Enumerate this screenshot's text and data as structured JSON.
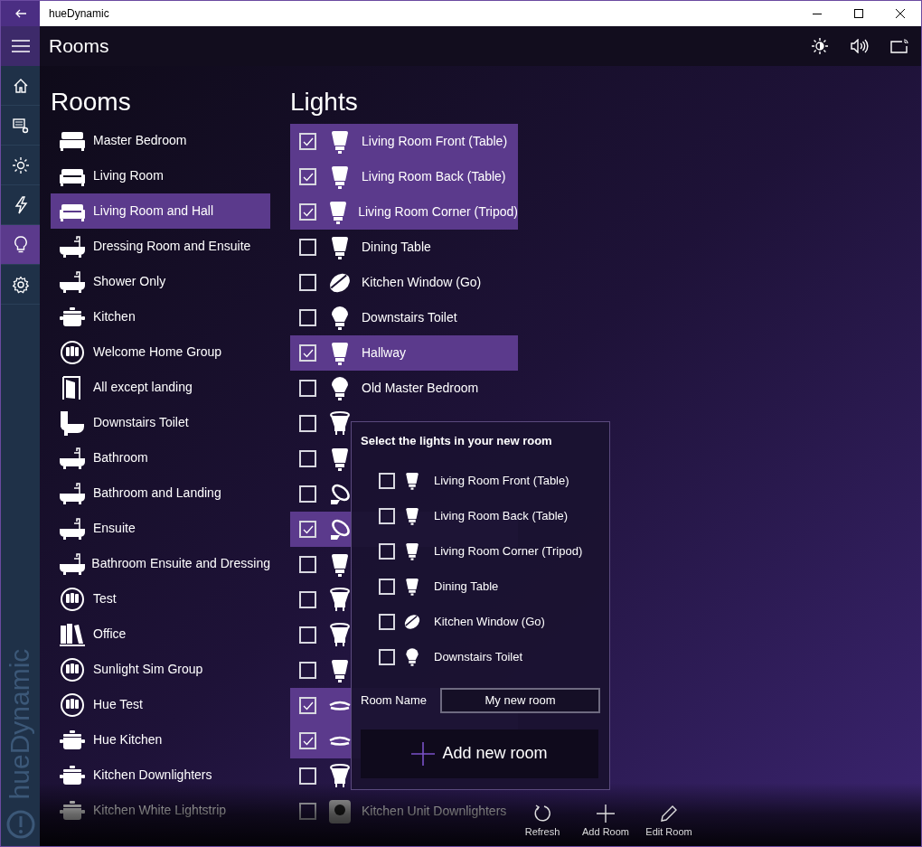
{
  "window": {
    "title": "hueDynamic"
  },
  "nav": {
    "brand": "hueDynamic",
    "items": [
      {
        "kind": "home",
        "selected": false
      },
      {
        "kind": "devices",
        "selected": false
      },
      {
        "kind": "sun",
        "selected": false
      },
      {
        "kind": "bolt",
        "selected": false
      },
      {
        "kind": "bulb",
        "selected": true
      },
      {
        "kind": "gear",
        "selected": false
      }
    ]
  },
  "header": {
    "title": "Rooms"
  },
  "rooms": {
    "heading": "Rooms",
    "items": [
      {
        "name": "Master Bedroom",
        "kind": "bed",
        "selected": false
      },
      {
        "name": "Living Room",
        "kind": "sofa",
        "selected": false
      },
      {
        "name": "Living Room and Hall",
        "kind": "sofa",
        "selected": true
      },
      {
        "name": "Dressing Room and Ensuite",
        "kind": "bath",
        "selected": false
      },
      {
        "name": "Shower Only",
        "kind": "bath",
        "selected": false
      },
      {
        "name": "Kitchen",
        "kind": "pot",
        "selected": false
      },
      {
        "name": "Welcome Home Group",
        "kind": "group",
        "selected": false
      },
      {
        "name": "All except landing",
        "kind": "door",
        "selected": false
      },
      {
        "name": "Downstairs Toilet",
        "kind": "toilet",
        "selected": false
      },
      {
        "name": "Bathroom",
        "kind": "bath",
        "selected": false
      },
      {
        "name": "Bathroom and Landing",
        "kind": "bath",
        "selected": false
      },
      {
        "name": "Ensuite",
        "kind": "bath",
        "selected": false
      },
      {
        "name": "Bathroom Ensuite and Dressing",
        "kind": "bath",
        "selected": false
      },
      {
        "name": "Test",
        "kind": "group",
        "selected": false
      },
      {
        "name": "Office",
        "kind": "books",
        "selected": false
      },
      {
        "name": "Sunlight Sim Group",
        "kind": "group",
        "selected": false
      },
      {
        "name": "Hue Test",
        "kind": "group",
        "selected": false
      },
      {
        "name": "Hue Kitchen",
        "kind": "pot",
        "selected": false
      },
      {
        "name": "Kitchen Downlighters",
        "kind": "pot",
        "selected": false
      },
      {
        "name": "Kitchen White Lightstrip",
        "kind": "pot",
        "selected": false
      }
    ]
  },
  "lights": {
    "heading": "Lights",
    "items": [
      {
        "name": "Living Room Front (Table)",
        "kind": "tall",
        "checked": true
      },
      {
        "name": "Living Room Back (Table)",
        "kind": "tall",
        "checked": true
      },
      {
        "name": "Living Room Corner (Tripod)",
        "kind": "tall",
        "checked": true
      },
      {
        "name": "Dining Table",
        "kind": "tall",
        "checked": false
      },
      {
        "name": "Kitchen Window (Go)",
        "kind": "go",
        "checked": false
      },
      {
        "name": "Downstairs Toilet",
        "kind": "bulb",
        "checked": false
      },
      {
        "name": "Hallway",
        "kind": "tall",
        "checked": true
      },
      {
        "name": "Old Master Bedroom",
        "kind": "bulb",
        "checked": false
      },
      {
        "kind": "spot",
        "checked": false
      },
      {
        "kind": "tall",
        "checked": false
      },
      {
        "kind": "bloom",
        "checked": false
      },
      {
        "kind": "bloom",
        "checked": true
      },
      {
        "kind": "tall",
        "checked": false
      },
      {
        "kind": "spot",
        "checked": false
      },
      {
        "kind": "spot",
        "checked": false
      },
      {
        "kind": "tall",
        "checked": false
      },
      {
        "kind": "ceiling",
        "checked": true
      },
      {
        "kind": "ceiling",
        "checked": true
      },
      {
        "kind": "spot",
        "checked": false
      },
      {
        "name": "Kitchen Unit Downlighters",
        "kind": "osram",
        "checked": false
      }
    ]
  },
  "popup": {
    "title": "Select the lights in your new room",
    "items": [
      {
        "name": "Living Room Front (Table)",
        "kind": "tall",
        "checked": false
      },
      {
        "name": "Living Room Back (Table)",
        "kind": "tall",
        "checked": false
      },
      {
        "name": "Living Room Corner (Tripod)",
        "kind": "tall",
        "checked": false
      },
      {
        "name": "Dining Table",
        "kind": "tall",
        "checked": false
      },
      {
        "name": "Kitchen Window (Go)",
        "kind": "go",
        "checked": false
      },
      {
        "name": "Downstairs Toilet",
        "kind": "bulb",
        "checked": false
      }
    ],
    "room_name_label": "Room Name",
    "room_name_value": "My new room",
    "add_button": "Add new room"
  },
  "app_bar": {
    "buttons": [
      {
        "label": "Refresh",
        "kind": "refresh"
      },
      {
        "label": "Add Room",
        "kind": "add"
      },
      {
        "label": "Edit Room",
        "kind": "edit"
      }
    ]
  }
}
